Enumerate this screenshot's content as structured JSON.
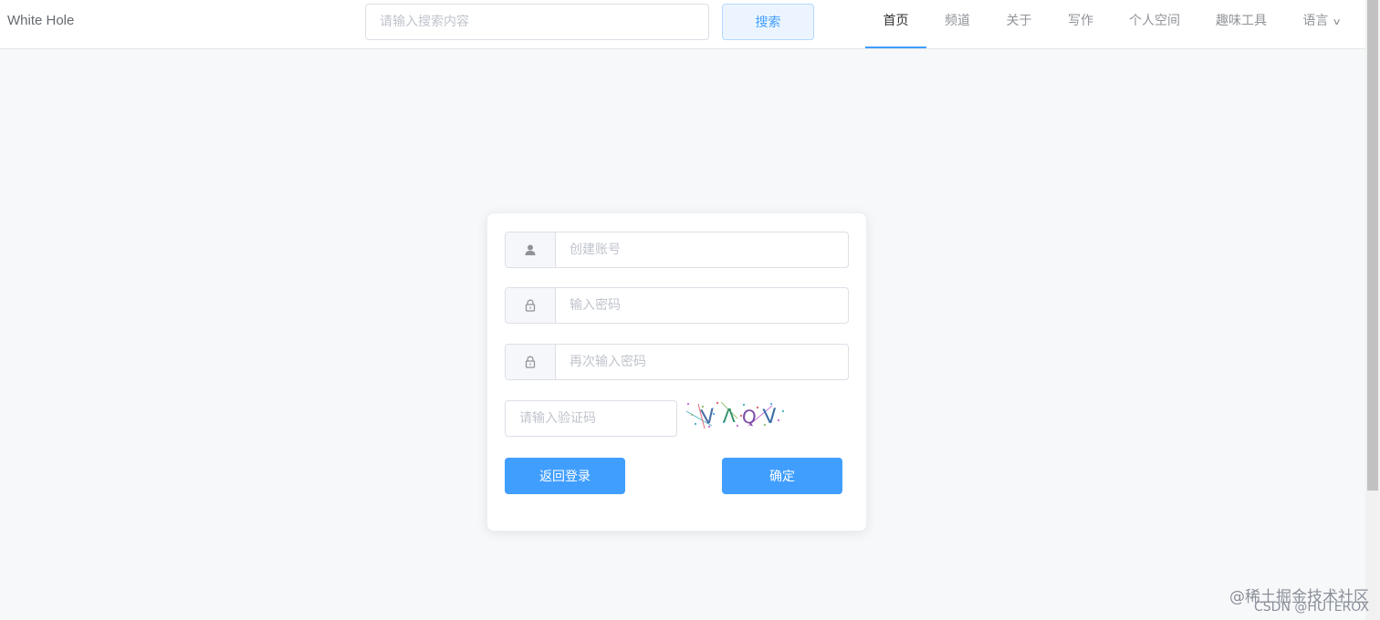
{
  "header": {
    "brand": "White Hole",
    "search": {
      "placeholder": "请输入搜索内容",
      "value": ""
    },
    "search_button": "搜索",
    "nav": [
      {
        "label": "首页",
        "active": true
      },
      {
        "label": "频道"
      },
      {
        "label": "关于"
      },
      {
        "label": "写作"
      },
      {
        "label": "个人空间"
      },
      {
        "label": "趣味工具"
      },
      {
        "label": "语言",
        "dropdown": true
      }
    ]
  },
  "register_form": {
    "account": {
      "icon": "user-icon",
      "placeholder": "创建账号",
      "value": ""
    },
    "password": {
      "icon": "lock-icon",
      "placeholder": "输入密码",
      "value": ""
    },
    "confirm_password": {
      "icon": "lock-icon",
      "placeholder": "再次输入密码",
      "value": ""
    },
    "captcha": {
      "placeholder": "请输入验证码",
      "value": "",
      "image_text": "VAQV"
    },
    "back_button": "返回登录",
    "confirm_button": "确定"
  },
  "watermark": {
    "line1": "@稀土掘金技术社区",
    "line2": "CSDN @HUTEROX"
  },
  "colors": {
    "primary": "#409eff",
    "background": "#f7f8f9",
    "border": "#dcdfe6"
  }
}
